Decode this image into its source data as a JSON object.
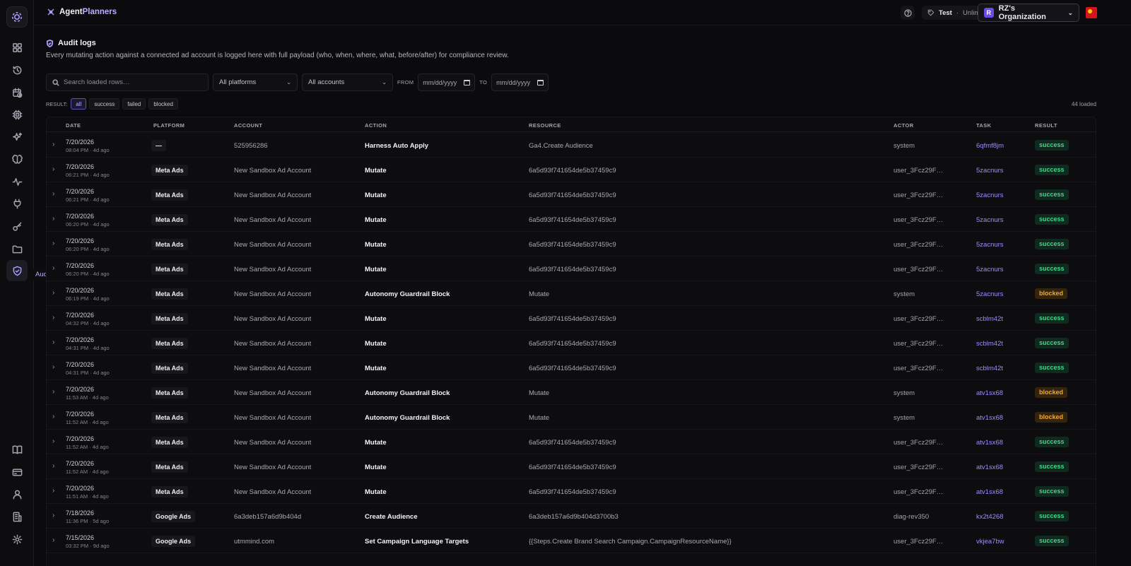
{
  "app": {
    "brand_part1": "Agent",
    "brand_part2": "Planners",
    "plan_env": "Test",
    "plan_sep": "·",
    "plan_tier": "Unlimited",
    "org_initial": "R",
    "org_name": "RZ's Organization",
    "accent": "#a79cff"
  },
  "rail": {
    "tooltip": "Audit",
    "items": [
      {
        "icon": "dashboard-icon"
      },
      {
        "icon": "history-icon"
      },
      {
        "icon": "calendar-clock-icon"
      },
      {
        "icon": "chip-icon"
      },
      {
        "icon": "sparkles-icon"
      },
      {
        "icon": "brain-icon"
      },
      {
        "icon": "activity-icon"
      },
      {
        "icon": "plug-icon"
      },
      {
        "icon": "key-icon"
      },
      {
        "icon": "folder-icon"
      },
      {
        "icon": "shield-icon",
        "active": true
      },
      {
        "icon": "book-icon"
      },
      {
        "icon": "credit-card-icon"
      },
      {
        "icon": "user-icon"
      },
      {
        "icon": "building-icon"
      },
      {
        "icon": "gear-icon"
      }
    ]
  },
  "page": {
    "title": "Audit logs",
    "subtitle": "Every mutating action against a connected ad account is logged here with full payload (who, when, where, what, before/after) for compliance review."
  },
  "filters": {
    "search_placeholder": "Search loaded rows…",
    "platform": "All platforms",
    "account": "All accounts",
    "from_label": "FROM",
    "to_label": "TO",
    "date_placeholder": "mm/dd/yyyy",
    "result_label": "RESULT:",
    "result_options": [
      "all",
      "success",
      "failed",
      "blocked"
    ],
    "result_selected": "all",
    "loaded_count": "44 loaded"
  },
  "table": {
    "columns": [
      "DATE",
      "PLATFORM",
      "ACCOUNT",
      "ACTION",
      "RESOURCE",
      "ACTOR",
      "TASK",
      "RESULT"
    ],
    "rows": [
      {
        "date": "7/20/2026",
        "time": "08:04 PM · 4d ago",
        "platform": "—",
        "account": "525956286",
        "action": "Harness Auto Apply",
        "resource": "Ga4.Create Audience",
        "actor": "system",
        "task": "6qfmf8jm",
        "result": "success"
      },
      {
        "date": "7/20/2026",
        "time": "06:21 PM · 4d ago",
        "platform": "Meta Ads",
        "account": "New Sandbox Ad Account",
        "action": "Mutate",
        "resource": "6a5d93f741654de5b37459c9",
        "actor": "user_3Fcz29F…",
        "task": "5zacnurs",
        "result": "success"
      },
      {
        "date": "7/20/2026",
        "time": "06:21 PM · 4d ago",
        "platform": "Meta Ads",
        "account": "New Sandbox Ad Account",
        "action": "Mutate",
        "resource": "6a5d93f741654de5b37459c9",
        "actor": "user_3Fcz29F…",
        "task": "5zacnurs",
        "result": "success"
      },
      {
        "date": "7/20/2026",
        "time": "06:20 PM · 4d ago",
        "platform": "Meta Ads",
        "account": "New Sandbox Ad Account",
        "action": "Mutate",
        "resource": "6a5d93f741654de5b37459c9",
        "actor": "user_3Fcz29F…",
        "task": "5zacnurs",
        "result": "success"
      },
      {
        "date": "7/20/2026",
        "time": "06:20 PM · 4d ago",
        "platform": "Meta Ads",
        "account": "New Sandbox Ad Account",
        "action": "Mutate",
        "resource": "6a5d93f741654de5b37459c9",
        "actor": "user_3Fcz29F…",
        "task": "5zacnurs",
        "result": "success"
      },
      {
        "date": "7/20/2026",
        "time": "06:20 PM · 4d ago",
        "platform": "Meta Ads",
        "account": "New Sandbox Ad Account",
        "action": "Mutate",
        "resource": "6a5d93f741654de5b37459c9",
        "actor": "user_3Fcz29F…",
        "task": "5zacnurs",
        "result": "success"
      },
      {
        "date": "7/20/2026",
        "time": "06:19 PM · 4d ago",
        "platform": "Meta Ads",
        "account": "New Sandbox Ad Account",
        "action": "Autonomy Guardrail Block",
        "resource": "Mutate",
        "actor": "system",
        "task": "5zacnurs",
        "result": "blocked"
      },
      {
        "date": "7/20/2026",
        "time": "04:32 PM · 4d ago",
        "platform": "Meta Ads",
        "account": "New Sandbox Ad Account",
        "action": "Mutate",
        "resource": "6a5d93f741654de5b37459c9",
        "actor": "user_3Fcz29F…",
        "task": "scblm42t",
        "result": "success"
      },
      {
        "date": "7/20/2026",
        "time": "04:31 PM · 4d ago",
        "platform": "Meta Ads",
        "account": "New Sandbox Ad Account",
        "action": "Mutate",
        "resource": "6a5d93f741654de5b37459c9",
        "actor": "user_3Fcz29F…",
        "task": "scblm42t",
        "result": "success"
      },
      {
        "date": "7/20/2026",
        "time": "04:31 PM · 4d ago",
        "platform": "Meta Ads",
        "account": "New Sandbox Ad Account",
        "action": "Mutate",
        "resource": "6a5d93f741654de5b37459c9",
        "actor": "user_3Fcz29F…",
        "task": "scblm42t",
        "result": "success"
      },
      {
        "date": "7/20/2026",
        "time": "11:53 AM · 4d ago",
        "platform": "Meta Ads",
        "account": "New Sandbox Ad Account",
        "action": "Autonomy Guardrail Block",
        "resource": "Mutate",
        "actor": "system",
        "task": "atv1sx68",
        "result": "blocked"
      },
      {
        "date": "7/20/2026",
        "time": "11:52 AM · 4d ago",
        "platform": "Meta Ads",
        "account": "New Sandbox Ad Account",
        "action": "Autonomy Guardrail Block",
        "resource": "Mutate",
        "actor": "system",
        "task": "atv1sx68",
        "result": "blocked"
      },
      {
        "date": "7/20/2026",
        "time": "11:52 AM · 4d ago",
        "platform": "Meta Ads",
        "account": "New Sandbox Ad Account",
        "action": "Mutate",
        "resource": "6a5d93f741654de5b37459c9",
        "actor": "user_3Fcz29F…",
        "task": "atv1sx68",
        "result": "success"
      },
      {
        "date": "7/20/2026",
        "time": "11:52 AM · 4d ago",
        "platform": "Meta Ads",
        "account": "New Sandbox Ad Account",
        "action": "Mutate",
        "resource": "6a5d93f741654de5b37459c9",
        "actor": "user_3Fcz29F…",
        "task": "atv1sx68",
        "result": "success"
      },
      {
        "date": "7/20/2026",
        "time": "11:51 AM · 4d ago",
        "platform": "Meta Ads",
        "account": "New Sandbox Ad Account",
        "action": "Mutate",
        "resource": "6a5d93f741654de5b37459c9",
        "actor": "user_3Fcz29F…",
        "task": "atv1sx68",
        "result": "success"
      },
      {
        "date": "7/18/2026",
        "time": "11:36 PM · 5d ago",
        "platform": "Google Ads",
        "account": "6a3deb157a6d9b404d",
        "action": "Create Audience",
        "resource": "6a3deb157a6d9b404d3700b3",
        "actor": "diag-rev350",
        "task": "kx2t4268",
        "result": "success"
      },
      {
        "date": "7/15/2026",
        "time": "03:32 PM · 9d ago",
        "platform": "Google Ads",
        "account": "utmmind.com",
        "action": "Set Campaign Language Targets",
        "resource": "{{Steps.Create Brand Search Campaign.CampaignResourceName}}",
        "actor": "user_3Fcz29F…",
        "task": "vkjea7bw",
        "result": "success"
      }
    ]
  }
}
